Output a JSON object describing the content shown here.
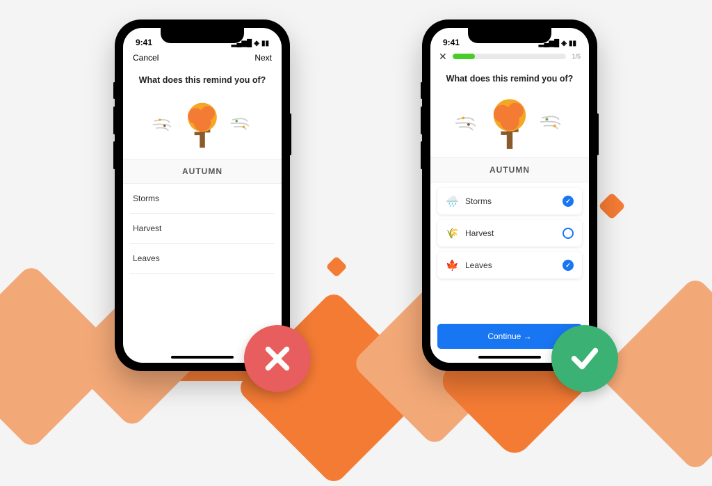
{
  "status_time": "9:41",
  "left": {
    "nav_cancel": "Cancel",
    "nav_next": "Next",
    "question": "What does this remind you of?",
    "word": "AUTUMN",
    "options": [
      "Storms",
      "Harvest",
      "Leaves"
    ]
  },
  "right": {
    "progress_text": "1/5",
    "question": "What does this remind you of?",
    "word": "AUTUMN",
    "options": [
      {
        "icon": "🌧️",
        "label": "Storms",
        "checked": true
      },
      {
        "icon": "🌾",
        "label": "Harvest",
        "checked": false
      },
      {
        "icon": "🍁",
        "label": "Leaves",
        "checked": true
      }
    ],
    "continue_label": "Continue →"
  },
  "verdicts": {
    "left": "bad",
    "right": "good"
  }
}
